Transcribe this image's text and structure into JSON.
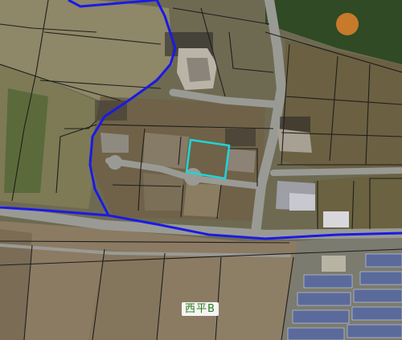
{
  "map": {
    "place_label": "西平B",
    "colors": {
      "district_boundary": "#1a1ae6",
      "selected_parcel": "#1fd6d6",
      "parcel_lines": "#1e1e1e",
      "farmland": "#8b7b63",
      "vegetation": "#4f5a35",
      "forest": "#2f4a25",
      "road": "#9a9a95",
      "solar_panels": "#5a6a9a"
    },
    "layers": [
      "aerial-photo",
      "parcel-lines",
      "district-boundary",
      "selected-parcel"
    ]
  }
}
